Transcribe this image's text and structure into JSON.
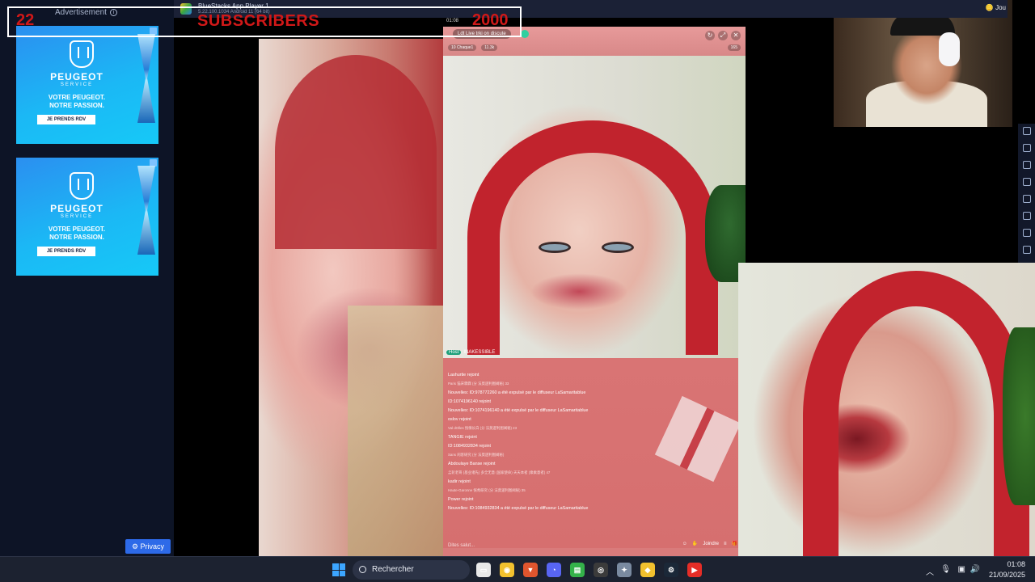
{
  "overlay": {
    "sub_count": "22",
    "sub_label": "SUBSCRIBERS",
    "sub_goal": "2000"
  },
  "ad": {
    "label": "Advertisement",
    "brand": "PEUGEOT",
    "service": "SERVICE",
    "slogan_1": "VOTRE PEUGEOT.",
    "slogan_2": "NOTRE PASSION.",
    "cta": "JE PRENDS RDV",
    "privacy": "Privacy"
  },
  "bluestacks": {
    "title": "BlueStacks App Player 1",
    "subtitle": "5.22.100.1034 Android 11 (64 bit)",
    "game_button": "Jou",
    "time": "01:08"
  },
  "live": {
    "title": "Ldt Live trki on discute",
    "stat_1": "10 Chaque1",
    "stat_2": "11.3k",
    "viewers": "165",
    "host_label": "Host",
    "host_name": "INAKESSIBLE",
    "chat_input_placeholder": "Dites salut...",
    "join_label": "Joindre"
  },
  "chat": [
    {
      "text": "Lashurtie rejoint",
      "sub": false
    },
    {
      "text": "Paris 猫宋霖霖 (分 法莫逻利图阀秘) 33",
      "sub": true
    },
    {
      "text": "Nouvelles: ID:978772260 a été expulsé par le diffuseur LaSamaritablue",
      "sub": false
    },
    {
      "text": "ID:1074196140 rejoint",
      "sub": false
    },
    {
      "text": "Nouvelles: ID:1074196140 a été expulsé par le diffuseur LaSamaritablue",
      "sub": false
    },
    {
      "text": "oslov rejoint",
      "sub": false
    },
    {
      "text": "Val dOlles 恍情长白 (分 法莫逻利图阀秘) 23",
      "sub": true
    },
    {
      "text": "TANGIE rejoint",
      "sub": false
    },
    {
      "text": "ID:1084932834 rejoint",
      "sub": false
    },
    {
      "text": "Sans 闲客研究 (分 法莫逻利图阀秘)",
      "sub": true
    },
    {
      "text": "Abdoulaye Banse rejoint",
      "sub": false
    },
    {
      "text": "孟轮老哥 (基业诸先) 多全无意 (国家使命) 天天本者 (乘乘意者) 47",
      "sub": true
    },
    {
      "text": "kadir rejoint",
      "sub": false
    },
    {
      "text": "Haute-Garonne 恍希研究 (分 法莫逻利图阀秘) 35",
      "sub": true
    },
    {
      "text": "Power rejoint",
      "sub": false
    },
    {
      "text": "Nouvelles: ID:1084932834 a été expulsé par le diffuseur LaSamaritablue",
      "sub": false
    }
  ],
  "taskbar": {
    "search_placeholder": "Rechercher",
    "time": "01:08",
    "date": "21/09/2025",
    "apps": [
      {
        "name": "file-explorer-icon",
        "color": "#e8e8e8",
        "glyph": "▭"
      },
      {
        "name": "chrome-icon",
        "color": "#f2c12e",
        "glyph": "◉"
      },
      {
        "name": "brave-icon",
        "color": "#e0552e",
        "glyph": "▼"
      },
      {
        "name": "discord-icon",
        "color": "#5865f2",
        "glyph": "◔"
      },
      {
        "name": "notes-icon",
        "color": "#34b24a",
        "glyph": "▤"
      },
      {
        "name": "obs-icon",
        "color": "#3b3b3b",
        "glyph": "◎"
      },
      {
        "name": "settings-icon",
        "color": "#7a8aa0",
        "glyph": "✦"
      },
      {
        "name": "bluestacks-icon",
        "color": "#f2c12e",
        "glyph": "◆"
      },
      {
        "name": "steam-icon",
        "color": "#1b2838",
        "glyph": "⚙"
      },
      {
        "name": "youtube-icon",
        "color": "#e52d27",
        "glyph": "▶"
      }
    ]
  }
}
